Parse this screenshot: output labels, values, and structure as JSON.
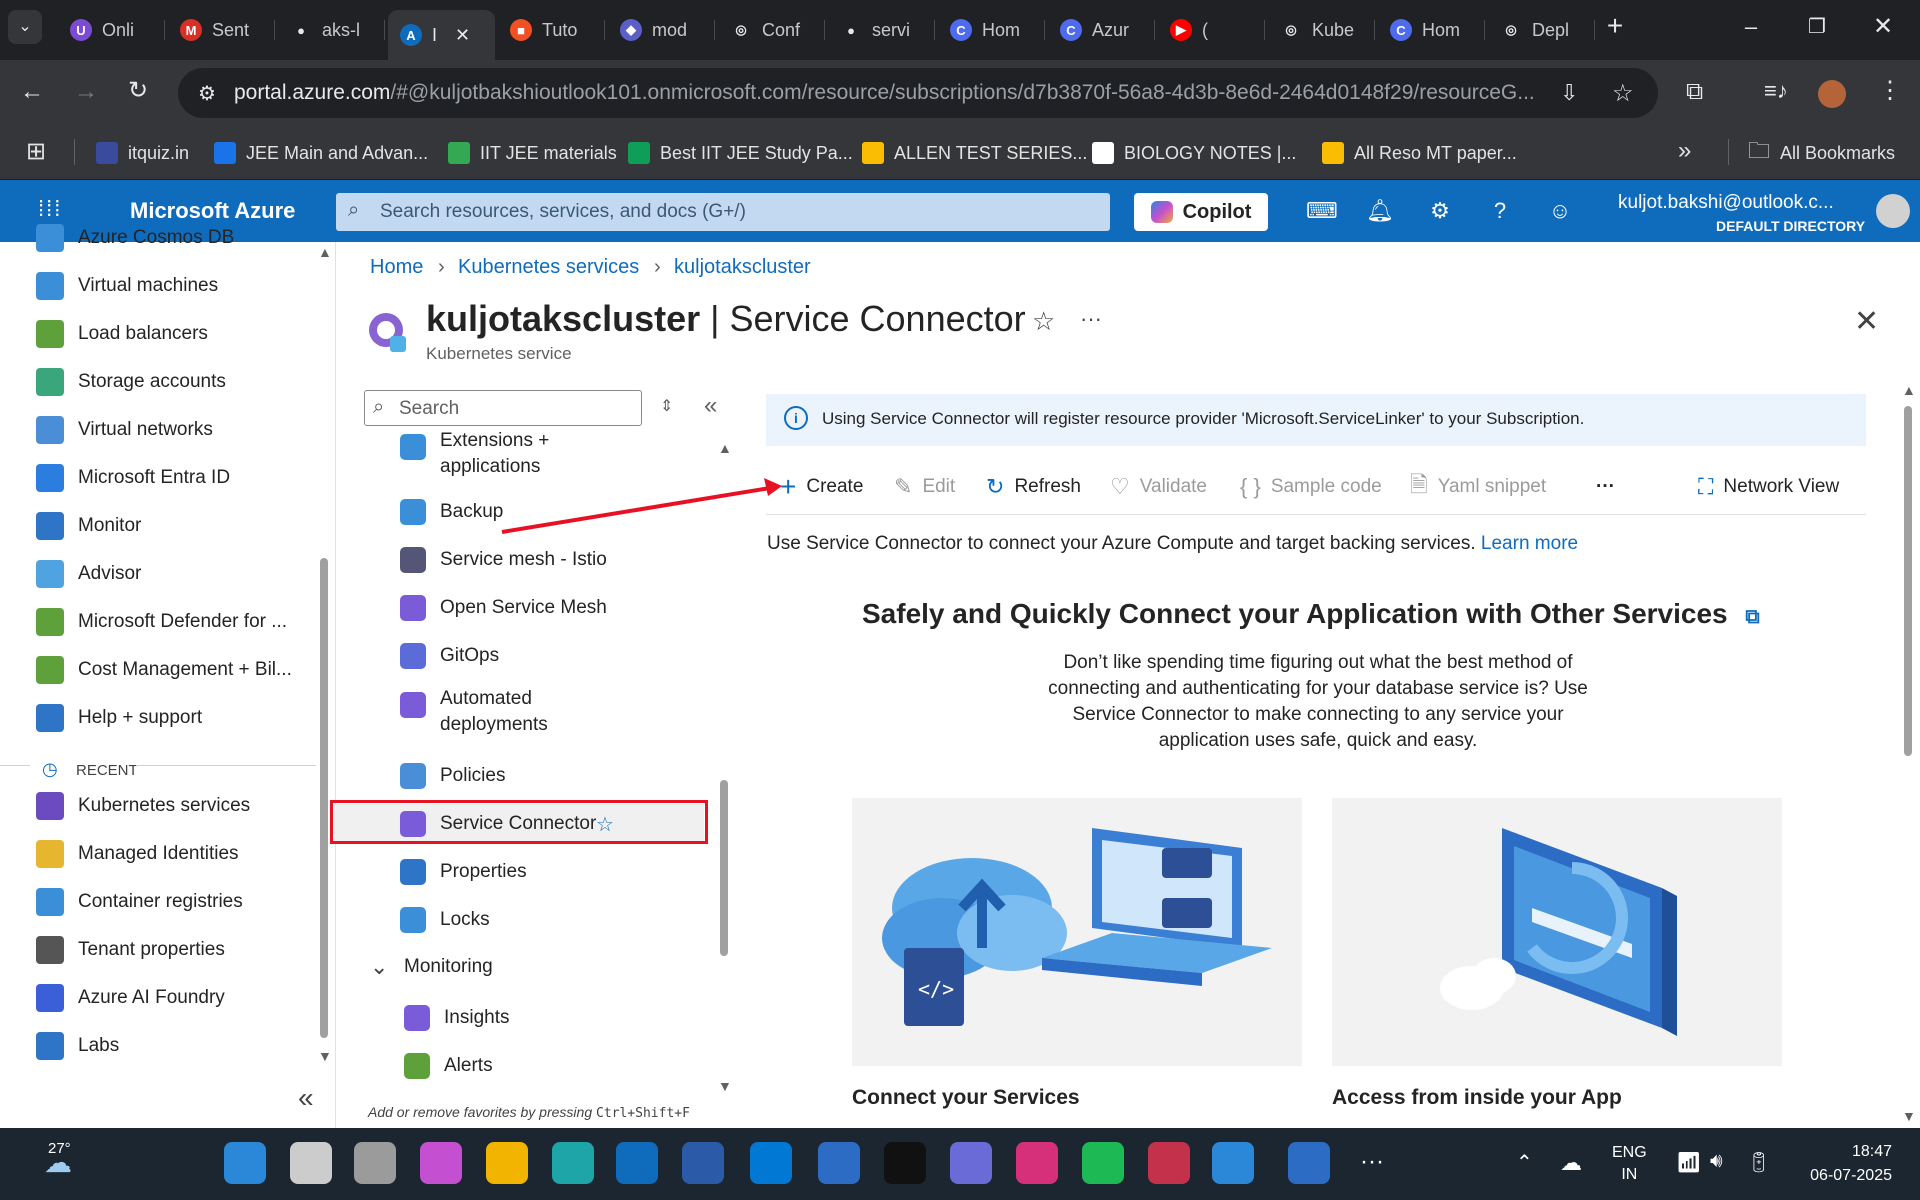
{
  "browser": {
    "tabs": [
      {
        "label": "Onli",
        "color": "#7b4bd4",
        "glyph": "U"
      },
      {
        "label": "Sent",
        "color": "#d93025",
        "glyph": "M"
      },
      {
        "label": "aks-l",
        "color": "#ffffff",
        "glyph": "●"
      },
      {
        "label": "I",
        "color": "#0f6cbd",
        "glyph": "A",
        "active": true
      },
      {
        "label": "Tuto",
        "color": "#f25022",
        "glyph": "■"
      },
      {
        "label": "mod",
        "color": "#5b5fc7",
        "glyph": "◆"
      },
      {
        "label": "Conf",
        "color": "#ffffff",
        "glyph": "◎"
      },
      {
        "label": "servi",
        "color": "#ffffff",
        "glyph": "●"
      },
      {
        "label": "Hom",
        "color": "#4f6bed",
        "glyph": "C"
      },
      {
        "label": "Azur",
        "color": "#4f6bed",
        "glyph": "C"
      },
      {
        "label": "(",
        "color": "#ff0000",
        "glyph": "▶"
      },
      {
        "label": "Kube",
        "color": "#ffffff",
        "glyph": "◎"
      },
      {
        "label": "Hom",
        "color": "#4f6bed",
        "glyph": "C"
      },
      {
        "label": "Depl",
        "color": "#ffffff",
        "glyph": "◎"
      }
    ],
    "url_host": "portal.azure.com",
    "url_rest": "/#@kuljotbakshioutlook101.onmicrosoft.com/resource/subscriptions/d7b3870f-56a8-4d3b-8e6d-2464d0148f29/resourceG...",
    "bookmarks": [
      {
        "label": "itquiz.in",
        "color": "#3a4a9c"
      },
      {
        "label": "JEE Main and Advan...",
        "color": "#1a73e8"
      },
      {
        "label": "IIT JEE materials",
        "color": "#34a853"
      },
      {
        "label": "Best IIT JEE Study Pa...",
        "color": "#0f9d58"
      },
      {
        "label": "ALLEN TEST SERIES...",
        "color": "#fbbc04"
      },
      {
        "label": "BIOLOGY NOTES |...",
        "color": "#ffffff"
      },
      {
        "label": "All Reso MT paper...",
        "color": "#fbbc04"
      }
    ],
    "all_bookmarks": "All Bookmarks"
  },
  "azure": {
    "brand": "Microsoft Azure",
    "search_placeholder": "Search resources, services, and docs (G+/)",
    "copilot": "Copilot",
    "user_email": "kuljot.bakshi@outlook.c...",
    "user_directory": "DEFAULT DIRECTORY",
    "accent": "#0f6cbd"
  },
  "leftnav": {
    "items": [
      {
        "label": "Azure Cosmos DB",
        "color": "#3a8fd8"
      },
      {
        "label": "Virtual machines",
        "color": "#3a8fd8"
      },
      {
        "label": "Load balancers",
        "color": "#5ea13b"
      },
      {
        "label": "Storage accounts",
        "color": "#3aa67b"
      },
      {
        "label": "Virtual networks",
        "color": "#4a8ed8"
      },
      {
        "label": "Microsoft Entra ID",
        "color": "#2b7de0"
      },
      {
        "label": "Monitor",
        "color": "#2e74c7"
      },
      {
        "label": "Advisor",
        "color": "#4fa3e0"
      },
      {
        "label": "Microsoft Defender for ...",
        "color": "#5ea13b"
      },
      {
        "label": "Cost Management + Bil...",
        "color": "#5ea13b"
      },
      {
        "label": "Help + support",
        "color": "#2e74c7"
      }
    ],
    "recent_label": "RECENT",
    "recent": [
      {
        "label": "Kubernetes services",
        "color": "#6b4bbf"
      },
      {
        "label": "Managed Identities",
        "color": "#e6b62e"
      },
      {
        "label": "Container registries",
        "color": "#3a8fd8"
      },
      {
        "label": "Tenant properties",
        "color": "#555555"
      },
      {
        "label": "Azure AI Foundry",
        "color": "#3b5fd8"
      },
      {
        "label": "Labs",
        "color": "#2e74c7"
      }
    ]
  },
  "breadcrumb": [
    "Home",
    "Kubernetes services",
    "kuljotakscluster"
  ],
  "resource": {
    "name": "kuljotakscluster",
    "section": "Service Connector",
    "type": "Kubernetes service"
  },
  "resnav": {
    "search_placeholder": "Search",
    "items": [
      {
        "label": "Extensions +",
        "label2": "applications",
        "color": "#3a8fd8"
      },
      {
        "label": "Backup",
        "color": "#3a8fd8"
      },
      {
        "label": "Service mesh - Istio",
        "color": "#555577"
      },
      {
        "label": "Open Service Mesh",
        "color": "#7a5bd8"
      },
      {
        "label": "GitOps",
        "color": "#5b6bd8"
      },
      {
        "label": "Automated",
        "label2": "deployments",
        "color": "#7a5bd8"
      },
      {
        "label": "Policies",
        "color": "#4a8ed8"
      },
      {
        "label": "Service Connector",
        "color": "#7a5bd8",
        "selected": true
      },
      {
        "label": "Properties",
        "color": "#2e74c7"
      },
      {
        "label": "Locks",
        "color": "#3a8fd8"
      }
    ],
    "group": "Monitoring",
    "group_items": [
      {
        "label": "Insights",
        "color": "#7a5bd8"
      },
      {
        "label": "Alerts",
        "color": "#5ea13b"
      }
    ],
    "footer": "Add or remove favorites by pressing ",
    "footer_keys": "Ctrl+Shift+F"
  },
  "main": {
    "info": "Using Service Connector will register resource provider 'Microsoft.ServiceLinker' to your Subscription.",
    "toolbar": {
      "create": "Create",
      "edit": "Edit",
      "refresh": "Refresh",
      "validate": "Validate",
      "sample_code": "Sample code",
      "yaml": "Yaml snippet",
      "more": "···",
      "network_view": "Network View"
    },
    "description": "Use Service Connector to connect your Azure Compute and target backing services.",
    "learn_more": "Learn more",
    "hero_title": "Safely and Quickly Connect your Application with Other Services",
    "hero_p1": "Don’t like spending time figuring out what the best method of",
    "hero_p2": "connecting and authenticating for your database service is? Use",
    "hero_p3": "Service Connector to make connecting to any service your",
    "hero_p4": "application uses safe, quick and easy.",
    "card1_title": "Connect your Services",
    "card2_title": "Access from inside your App"
  },
  "taskbar": {
    "temperature": "27°",
    "lang1": "ENG",
    "lang2": "IN",
    "time": "18:47",
    "date": "06-07-2025"
  }
}
